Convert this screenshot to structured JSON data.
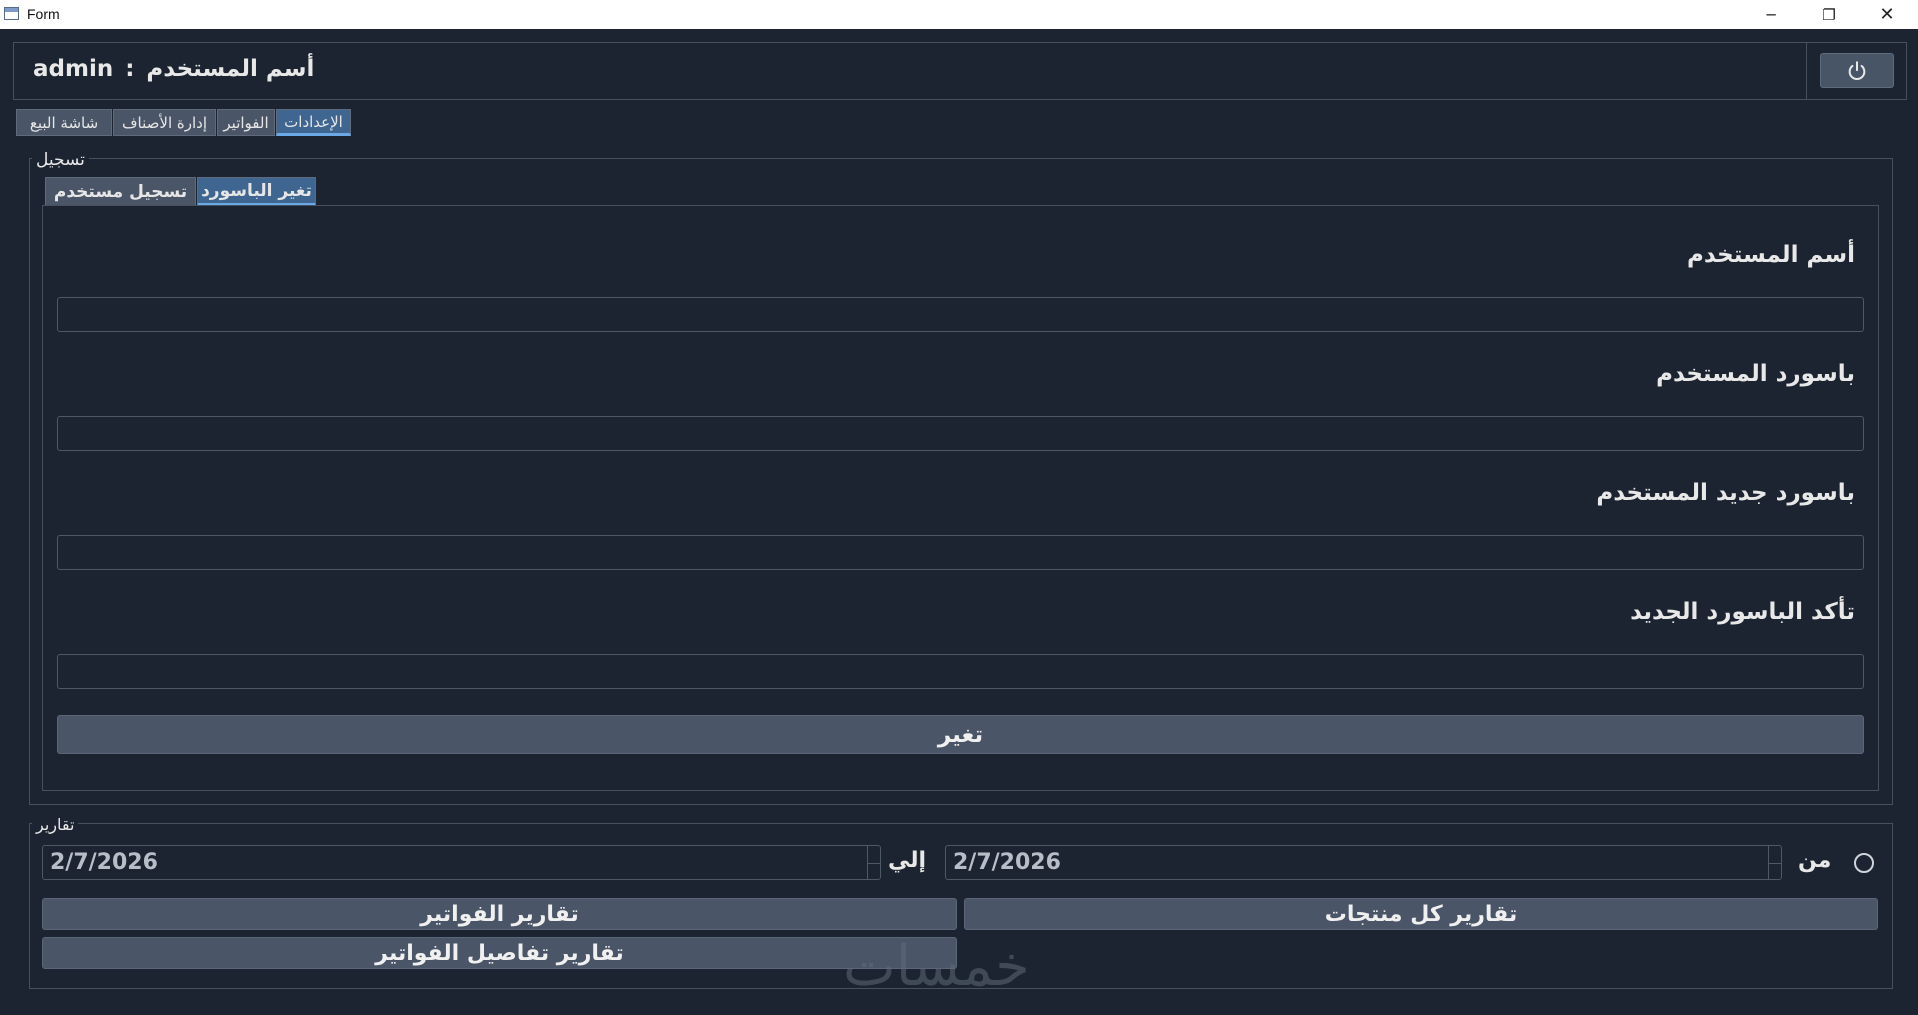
{
  "window": {
    "title": "Form",
    "minimize_glyph": "─",
    "maximize_glyph": "❐",
    "close_glyph": "✕"
  },
  "header": {
    "username": "admin",
    "separator": ":",
    "user_label": "أسم المستخدم"
  },
  "main_tabs": [
    {
      "label": "الإعدادات",
      "active": true
    },
    {
      "label": "الفواتير",
      "active": false
    },
    {
      "label": "إدارة الأصناف",
      "active": false
    },
    {
      "label": "شاشة البيع",
      "active": false
    }
  ],
  "registration": {
    "group_title": "تسجيل",
    "tabs": [
      {
        "label": "تغير الباسورد",
        "active": true
      },
      {
        "label": "تسجيل مستخدم",
        "active": false
      }
    ],
    "fields": [
      {
        "label": "أسم المستخدم",
        "value": ""
      },
      {
        "label": "باسورد المستخدم",
        "value": ""
      },
      {
        "label": "باسورد جديد المستخدم",
        "value": ""
      },
      {
        "label": "تأكد الباسورد الجديد",
        "value": ""
      }
    ],
    "submit_label": "تغير"
  },
  "reports": {
    "group_title": "تقارير",
    "from_label": "من",
    "to_label": "إلي",
    "from_date": "2/7/2026",
    "to_date": "2/7/2026",
    "all_products_label": "تقارير كل منتجات",
    "invoices_label": "تقارير الفواتير",
    "invoice_details_label": "تقارير تفاصيل الفواتير"
  },
  "watermark": "خمسات",
  "colors": {
    "background": "#1b2430",
    "button": "#4a5668",
    "active_tab": "#3f6690",
    "accent": "#6aa8e6"
  },
  "icons": {
    "power": "power-icon",
    "app": "app-icon"
  }
}
